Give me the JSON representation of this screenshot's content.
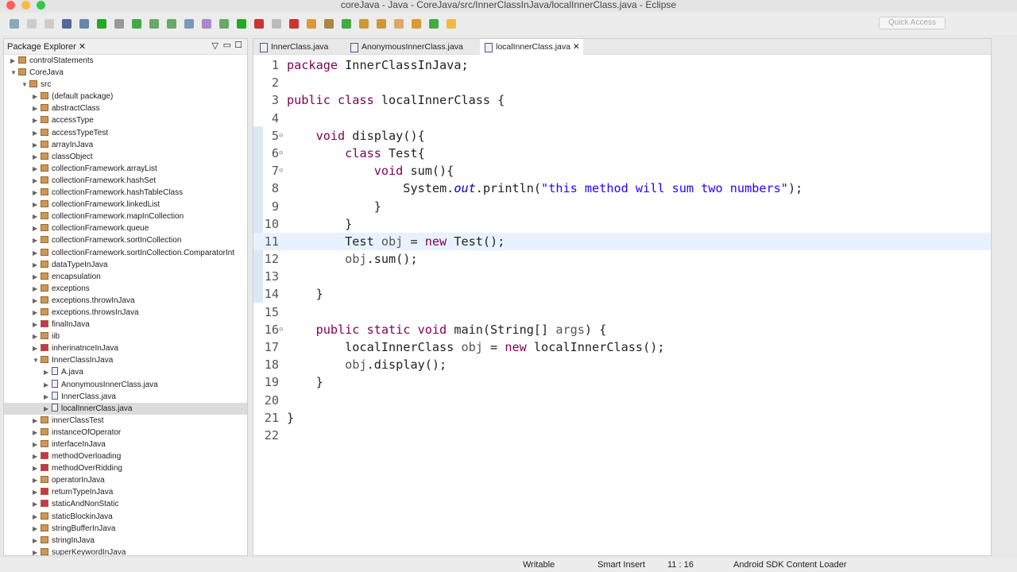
{
  "window": {
    "title": "coreJava - Java - CoreJava/src/InnerClassInJava/localInnerClass.java - Eclipse",
    "quick_access": "Quick Access"
  },
  "package_explorer": {
    "title": "Package Explorer",
    "items": [
      {
        "label": "controlStatements",
        "depth": 0,
        "type": "project",
        "arrow": "▶"
      },
      {
        "label": "CoreJava",
        "depth": 0,
        "type": "project",
        "arrow": "▼"
      },
      {
        "label": "src",
        "depth": 1,
        "type": "src",
        "arrow": "▼"
      },
      {
        "label": "(default package)",
        "depth": 2,
        "type": "pkg",
        "arrow": "▶"
      },
      {
        "label": "abstractClass",
        "depth": 2,
        "type": "pkg",
        "arrow": "▶"
      },
      {
        "label": "accessType",
        "depth": 2,
        "type": "pkg",
        "arrow": "▶"
      },
      {
        "label": "accessTypeTest",
        "depth": 2,
        "type": "pkg",
        "arrow": "▶"
      },
      {
        "label": "arrayInJava",
        "depth": 2,
        "type": "pkg",
        "arrow": "▶"
      },
      {
        "label": "classObject",
        "depth": 2,
        "type": "pkg",
        "arrow": "▶"
      },
      {
        "label": "collectionFramework.arrayList",
        "depth": 2,
        "type": "pkg",
        "arrow": "▶"
      },
      {
        "label": "collectionFramework.hashSet",
        "depth": 2,
        "type": "pkg",
        "arrow": "▶"
      },
      {
        "label": "collectionFramework.hashTableClass",
        "depth": 2,
        "type": "pkg",
        "arrow": "▶"
      },
      {
        "label": "collectionFramework.linkedList",
        "depth": 2,
        "type": "pkg",
        "arrow": "▶"
      },
      {
        "label": "collectionFramework.mapInCollection",
        "depth": 2,
        "type": "pkg",
        "arrow": "▶"
      },
      {
        "label": "collectionFramework.queue",
        "depth": 2,
        "type": "pkg",
        "arrow": "▶"
      },
      {
        "label": "collectionFramework.sortInCollection",
        "depth": 2,
        "type": "pkg",
        "arrow": "▶"
      },
      {
        "label": "collectionFramework.sortInCollection.ComparatorInt",
        "depth": 2,
        "type": "pkg",
        "arrow": "▶"
      },
      {
        "label": "dataTypeInJava",
        "depth": 2,
        "type": "pkg",
        "arrow": "▶"
      },
      {
        "label": "encapsulation",
        "depth": 2,
        "type": "pkg",
        "arrow": "▶"
      },
      {
        "label": "exceptions",
        "depth": 2,
        "type": "pkg",
        "arrow": "▶"
      },
      {
        "label": "exceptions.throwInJava",
        "depth": 2,
        "type": "pkg",
        "arrow": "▶"
      },
      {
        "label": "exceptions.throwsInJava",
        "depth": 2,
        "type": "pkg",
        "arrow": "▶"
      },
      {
        "label": "finalInJava",
        "depth": 2,
        "type": "err",
        "arrow": "▶"
      },
      {
        "label": "iib",
        "depth": 2,
        "type": "pkg",
        "arrow": "▶"
      },
      {
        "label": "inherinatnceInJava",
        "depth": 2,
        "type": "err",
        "arrow": "▶"
      },
      {
        "label": "InnerClassInJava",
        "depth": 2,
        "type": "pkg",
        "arrow": "▼"
      },
      {
        "label": "A.java",
        "depth": 3,
        "type": "file",
        "arrow": "▶"
      },
      {
        "label": "AnonymousInnerClass.java",
        "depth": 3,
        "type": "file",
        "arrow": "▶"
      },
      {
        "label": "InnerClass.java",
        "depth": 3,
        "type": "file",
        "arrow": "▶"
      },
      {
        "label": "localInnerClass.java",
        "depth": 3,
        "type": "file",
        "arrow": "▶",
        "selected": true
      },
      {
        "label": "innerClassTest",
        "depth": 2,
        "type": "pkg",
        "arrow": "▶"
      },
      {
        "label": "instanceOfOperator",
        "depth": 2,
        "type": "pkg",
        "arrow": "▶"
      },
      {
        "label": "interfaceInJava",
        "depth": 2,
        "type": "pkg",
        "arrow": "▶"
      },
      {
        "label": "methodOverloading",
        "depth": 2,
        "type": "err",
        "arrow": "▶"
      },
      {
        "label": "methodOverRidding",
        "depth": 2,
        "type": "err",
        "arrow": "▶"
      },
      {
        "label": "operatorInJava",
        "depth": 2,
        "type": "pkg",
        "arrow": "▶"
      },
      {
        "label": "returnTypeInJava",
        "depth": 2,
        "type": "err",
        "arrow": "▶"
      },
      {
        "label": "staticAndNonStatic",
        "depth": 2,
        "type": "err",
        "arrow": "▶"
      },
      {
        "label": "staticBlockinJava",
        "depth": 2,
        "type": "pkg",
        "arrow": "▶"
      },
      {
        "label": "stringBufferInJava",
        "depth": 2,
        "type": "pkg",
        "arrow": "▶"
      },
      {
        "label": "stringInJava",
        "depth": 2,
        "type": "pkg",
        "arrow": "▶"
      },
      {
        "label": "superKeywordInJava",
        "depth": 2,
        "type": "pkg",
        "arrow": "▶"
      }
    ]
  },
  "editor": {
    "tabs": [
      {
        "label": "InnerClass.java"
      },
      {
        "label": "AnonymousInnerClass.java"
      },
      {
        "label": "localInnerClass.java",
        "active": true
      }
    ],
    "current_line": 11,
    "lines": [
      {
        "n": "1",
        "t": [
          [
            "package",
            "kw"
          ],
          [
            " InnerClassInJava;",
            ""
          ]
        ]
      },
      {
        "n": "2",
        "t": []
      },
      {
        "n": "3",
        "t": [
          [
            "public class",
            "kw"
          ],
          [
            " localInnerClass {",
            ""
          ]
        ]
      },
      {
        "n": "4",
        "t": []
      },
      {
        "n": "5",
        "fold": true,
        "t": [
          [
            "    ",
            ""
          ],
          [
            "void",
            "kw"
          ],
          [
            " display(){",
            ""
          ]
        ]
      },
      {
        "n": "6",
        "fold": true,
        "t": [
          [
            "        ",
            ""
          ],
          [
            "class",
            "kw"
          ],
          [
            " Test{",
            ""
          ]
        ]
      },
      {
        "n": "7",
        "fold": true,
        "t": [
          [
            "            ",
            ""
          ],
          [
            "void",
            "kw"
          ],
          [
            " sum(){",
            ""
          ]
        ]
      },
      {
        "n": "8",
        "t": [
          [
            "                System.",
            ""
          ],
          [
            "out",
            "fld"
          ],
          [
            ".println(",
            ""
          ],
          [
            "\"this method will sum two numbers\"",
            "str"
          ],
          [
            ");",
            ""
          ]
        ]
      },
      {
        "n": "9",
        "t": [
          [
            "            }",
            ""
          ]
        ]
      },
      {
        "n": "10",
        "t": [
          [
            "        }",
            ""
          ]
        ]
      },
      {
        "n": "11",
        "t": [
          [
            "        Test ",
            ""
          ],
          [
            "obj",
            "occ"
          ],
          [
            " = ",
            ""
          ],
          [
            "new",
            "kw"
          ],
          [
            " Test();",
            ""
          ]
        ]
      },
      {
        "n": "12",
        "t": [
          [
            "        ",
            ""
          ],
          [
            "obj",
            "occ"
          ],
          [
            ".sum();",
            ""
          ]
        ]
      },
      {
        "n": "13",
        "t": []
      },
      {
        "n": "14",
        "t": [
          [
            "    }",
            ""
          ]
        ]
      },
      {
        "n": "15",
        "t": []
      },
      {
        "n": "16",
        "fold": true,
        "t": [
          [
            "    ",
            ""
          ],
          [
            "public static void",
            "kw"
          ],
          [
            " main(String[] ",
            ""
          ],
          [
            "args",
            "occ"
          ],
          [
            ") {",
            ""
          ]
        ]
      },
      {
        "n": "17",
        "t": [
          [
            "        localInnerClass ",
            ""
          ],
          [
            "obj",
            "occ"
          ],
          [
            " = ",
            ""
          ],
          [
            "new",
            "kw"
          ],
          [
            " localInnerClass();",
            ""
          ]
        ]
      },
      {
        "n": "18",
        "t": [
          [
            "        ",
            ""
          ],
          [
            "obj",
            "occ"
          ],
          [
            ".display();",
            ""
          ]
        ]
      },
      {
        "n": "19",
        "t": [
          [
            "    }",
            ""
          ]
        ]
      },
      {
        "n": "20",
        "t": []
      },
      {
        "n": "21",
        "t": [
          [
            "}",
            ""
          ]
        ]
      },
      {
        "n": "22",
        "t": []
      }
    ]
  },
  "status": {
    "writable": "Writable",
    "insert_mode": "Smart Insert",
    "position": "11 : 16",
    "task": "Android SDK Content Loader"
  },
  "colors": {
    "keyword": "#7f0055",
    "string": "#2a00ff",
    "field": "#0000c0",
    "current_line": "#e8f2fe"
  }
}
